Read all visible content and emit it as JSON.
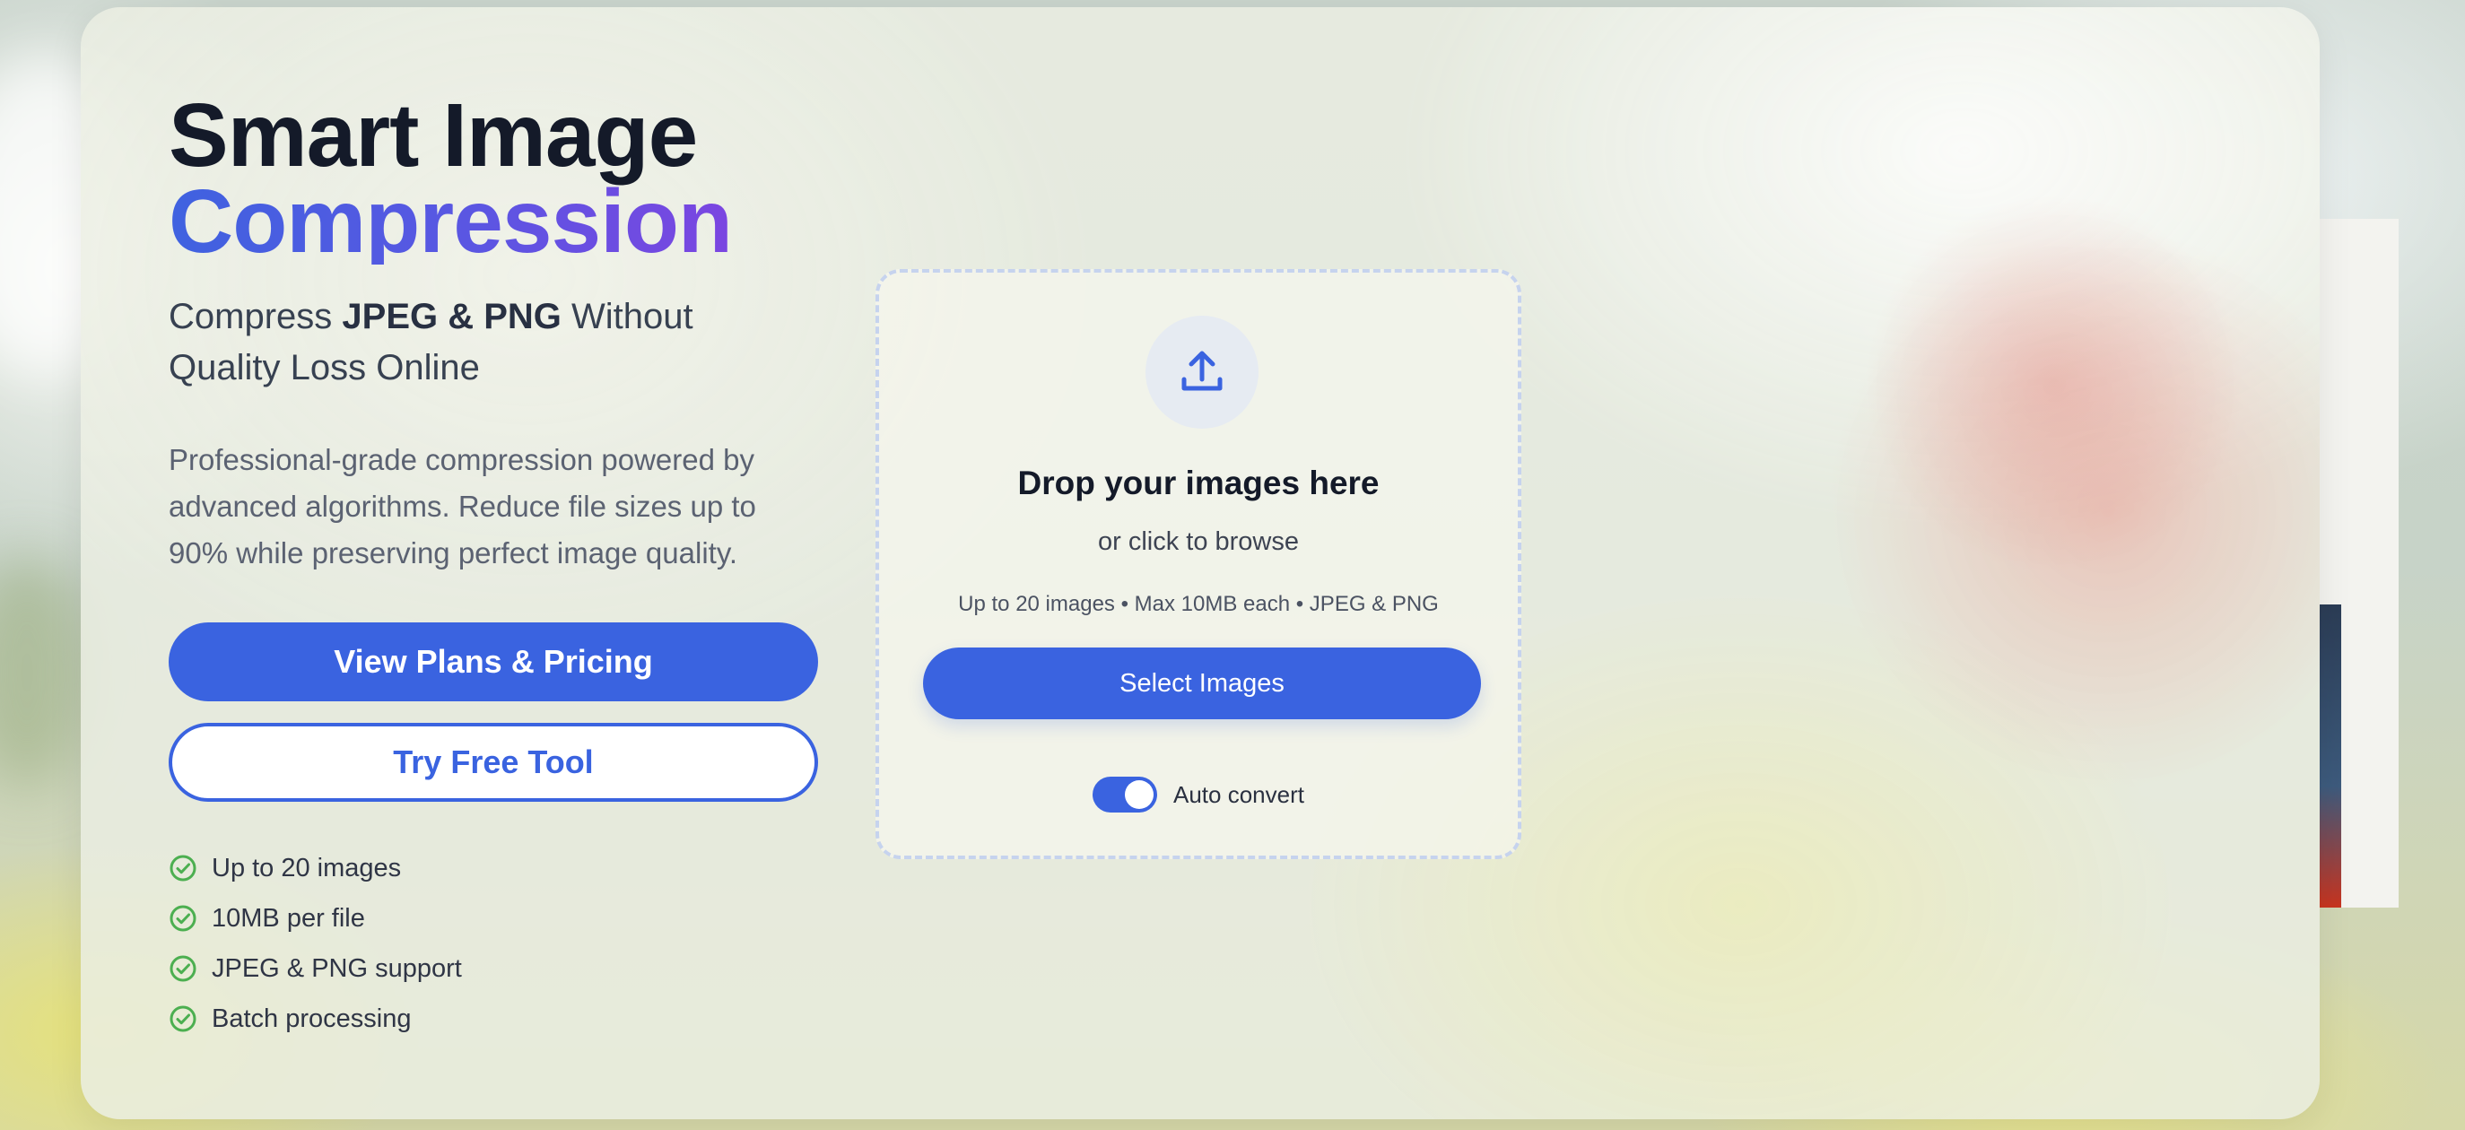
{
  "hero": {
    "title_line1": "Smart Image",
    "title_line2": "Compression",
    "subtitle_pre": "Compress ",
    "subtitle_bold": "JPEG & PNG",
    "subtitle_post": " Without Quality Loss Online",
    "description": "Professional-grade compression powered by advanced algorithms. Reduce file sizes up to 90% while preserving perfect image quality."
  },
  "buttons": {
    "primary_label": "View Plans & Pricing",
    "secondary_label": "Try Free Tool"
  },
  "features": [
    {
      "label": "Up to 20 images",
      "icon": "check-circle-icon"
    },
    {
      "label": "10MB per file",
      "icon": "check-circle-icon"
    },
    {
      "label": "JPEG & PNG support",
      "icon": "check-circle-icon"
    },
    {
      "label": "Batch processing",
      "icon": "check-circle-icon"
    }
  ],
  "dropzone": {
    "icon": "upload-icon",
    "title": "Drop your images here",
    "subtitle": "or click to browse",
    "limits": "Up to 20 images • Max 10MB each • JPEG & PNG",
    "select_label": "Select Images",
    "toggle_label": "Auto convert",
    "toggle_on": true
  },
  "colors": {
    "accent": "#3a63e0",
    "check": "#4caf50",
    "title_dark": "#141a29"
  }
}
